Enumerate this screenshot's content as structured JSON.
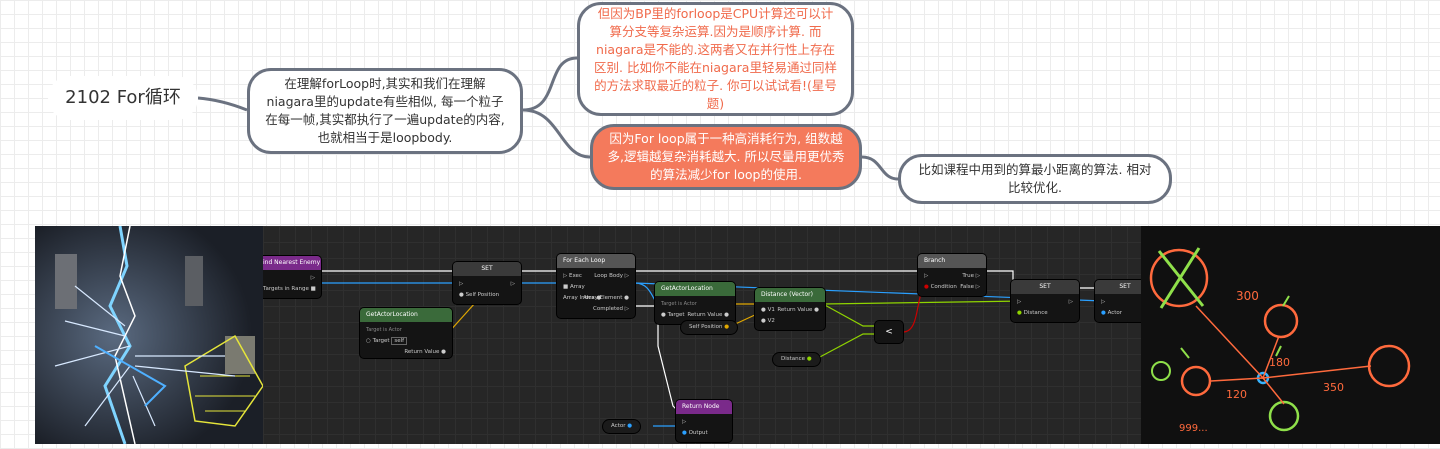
{
  "root": {
    "title": "2102 For循环"
  },
  "nodes": {
    "n1": "在理解forLoop时,其实和我们在理解niagara里的update有些相似, 每一个粒子在每一帧,其实都执行了一遍update的内容,也就相当于是loopbody.",
    "n2": "但因为BP里的forloop是CPU计算还可以计算分支等复杂运算.因为是顺序计算. 而niagara是不能的.这两者又在并行性上存在区别. 比如你不能在niagara里轻易通过同样的方法求取最近的粒子. 你可以试试看!(星号题)",
    "n3": "因为For loop属于一种高消耗行为, 组数越多,逻辑越复杂消耗越大. 所以尽量用更优秀的算法减少for loop的使用.",
    "n4": "比如课程中用到的算最小距离的算法. 相对比较优化."
  },
  "colors": {
    "accent": "#f47a5c",
    "border": "#6b7280",
    "highlight_text": "#f06a4b"
  },
  "blueprint": {
    "find_nearest": {
      "title": "ind Nearest Enemy",
      "pin": "Targets in Range"
    },
    "set1": {
      "title": "SET",
      "pin": "Self Position"
    },
    "get_actor_loc1": {
      "title": "GetActorLocation",
      "sub": "Target is Actor",
      "target": "Target",
      "self": "self",
      "ret": "Return Value"
    },
    "foreach": {
      "title": "For Each Loop",
      "exec": "Exec",
      "array": "Array",
      "loop_body": "Loop Body",
      "array_element": "Array Element",
      "array_index": "Array Index",
      "completed": "Completed"
    },
    "get_actor_loc2": {
      "title": "GetActorLocation",
      "sub": "Target is Actor",
      "target": "Target",
      "ret": "Return Value"
    },
    "distance": {
      "title": "Distance (Vector)",
      "v1": "V1",
      "v2": "V2",
      "ret": "Return Value"
    },
    "self_position_var": "Self Position",
    "distance_var": "Distance",
    "compare": "<",
    "branch": {
      "title": "Branch",
      "condition": "Condition",
      "true": "True",
      "false": "False"
    },
    "set2": {
      "title": "SET",
      "pin": "Distance"
    },
    "set3": {
      "title": "SET",
      "pin": "Actor"
    },
    "return_node": {
      "title": "Return Node",
      "output": "Output"
    },
    "actor_var": "Actor"
  },
  "sketch": {
    "labels": [
      "300",
      "180",
      "350",
      "120",
      "999..."
    ]
  }
}
